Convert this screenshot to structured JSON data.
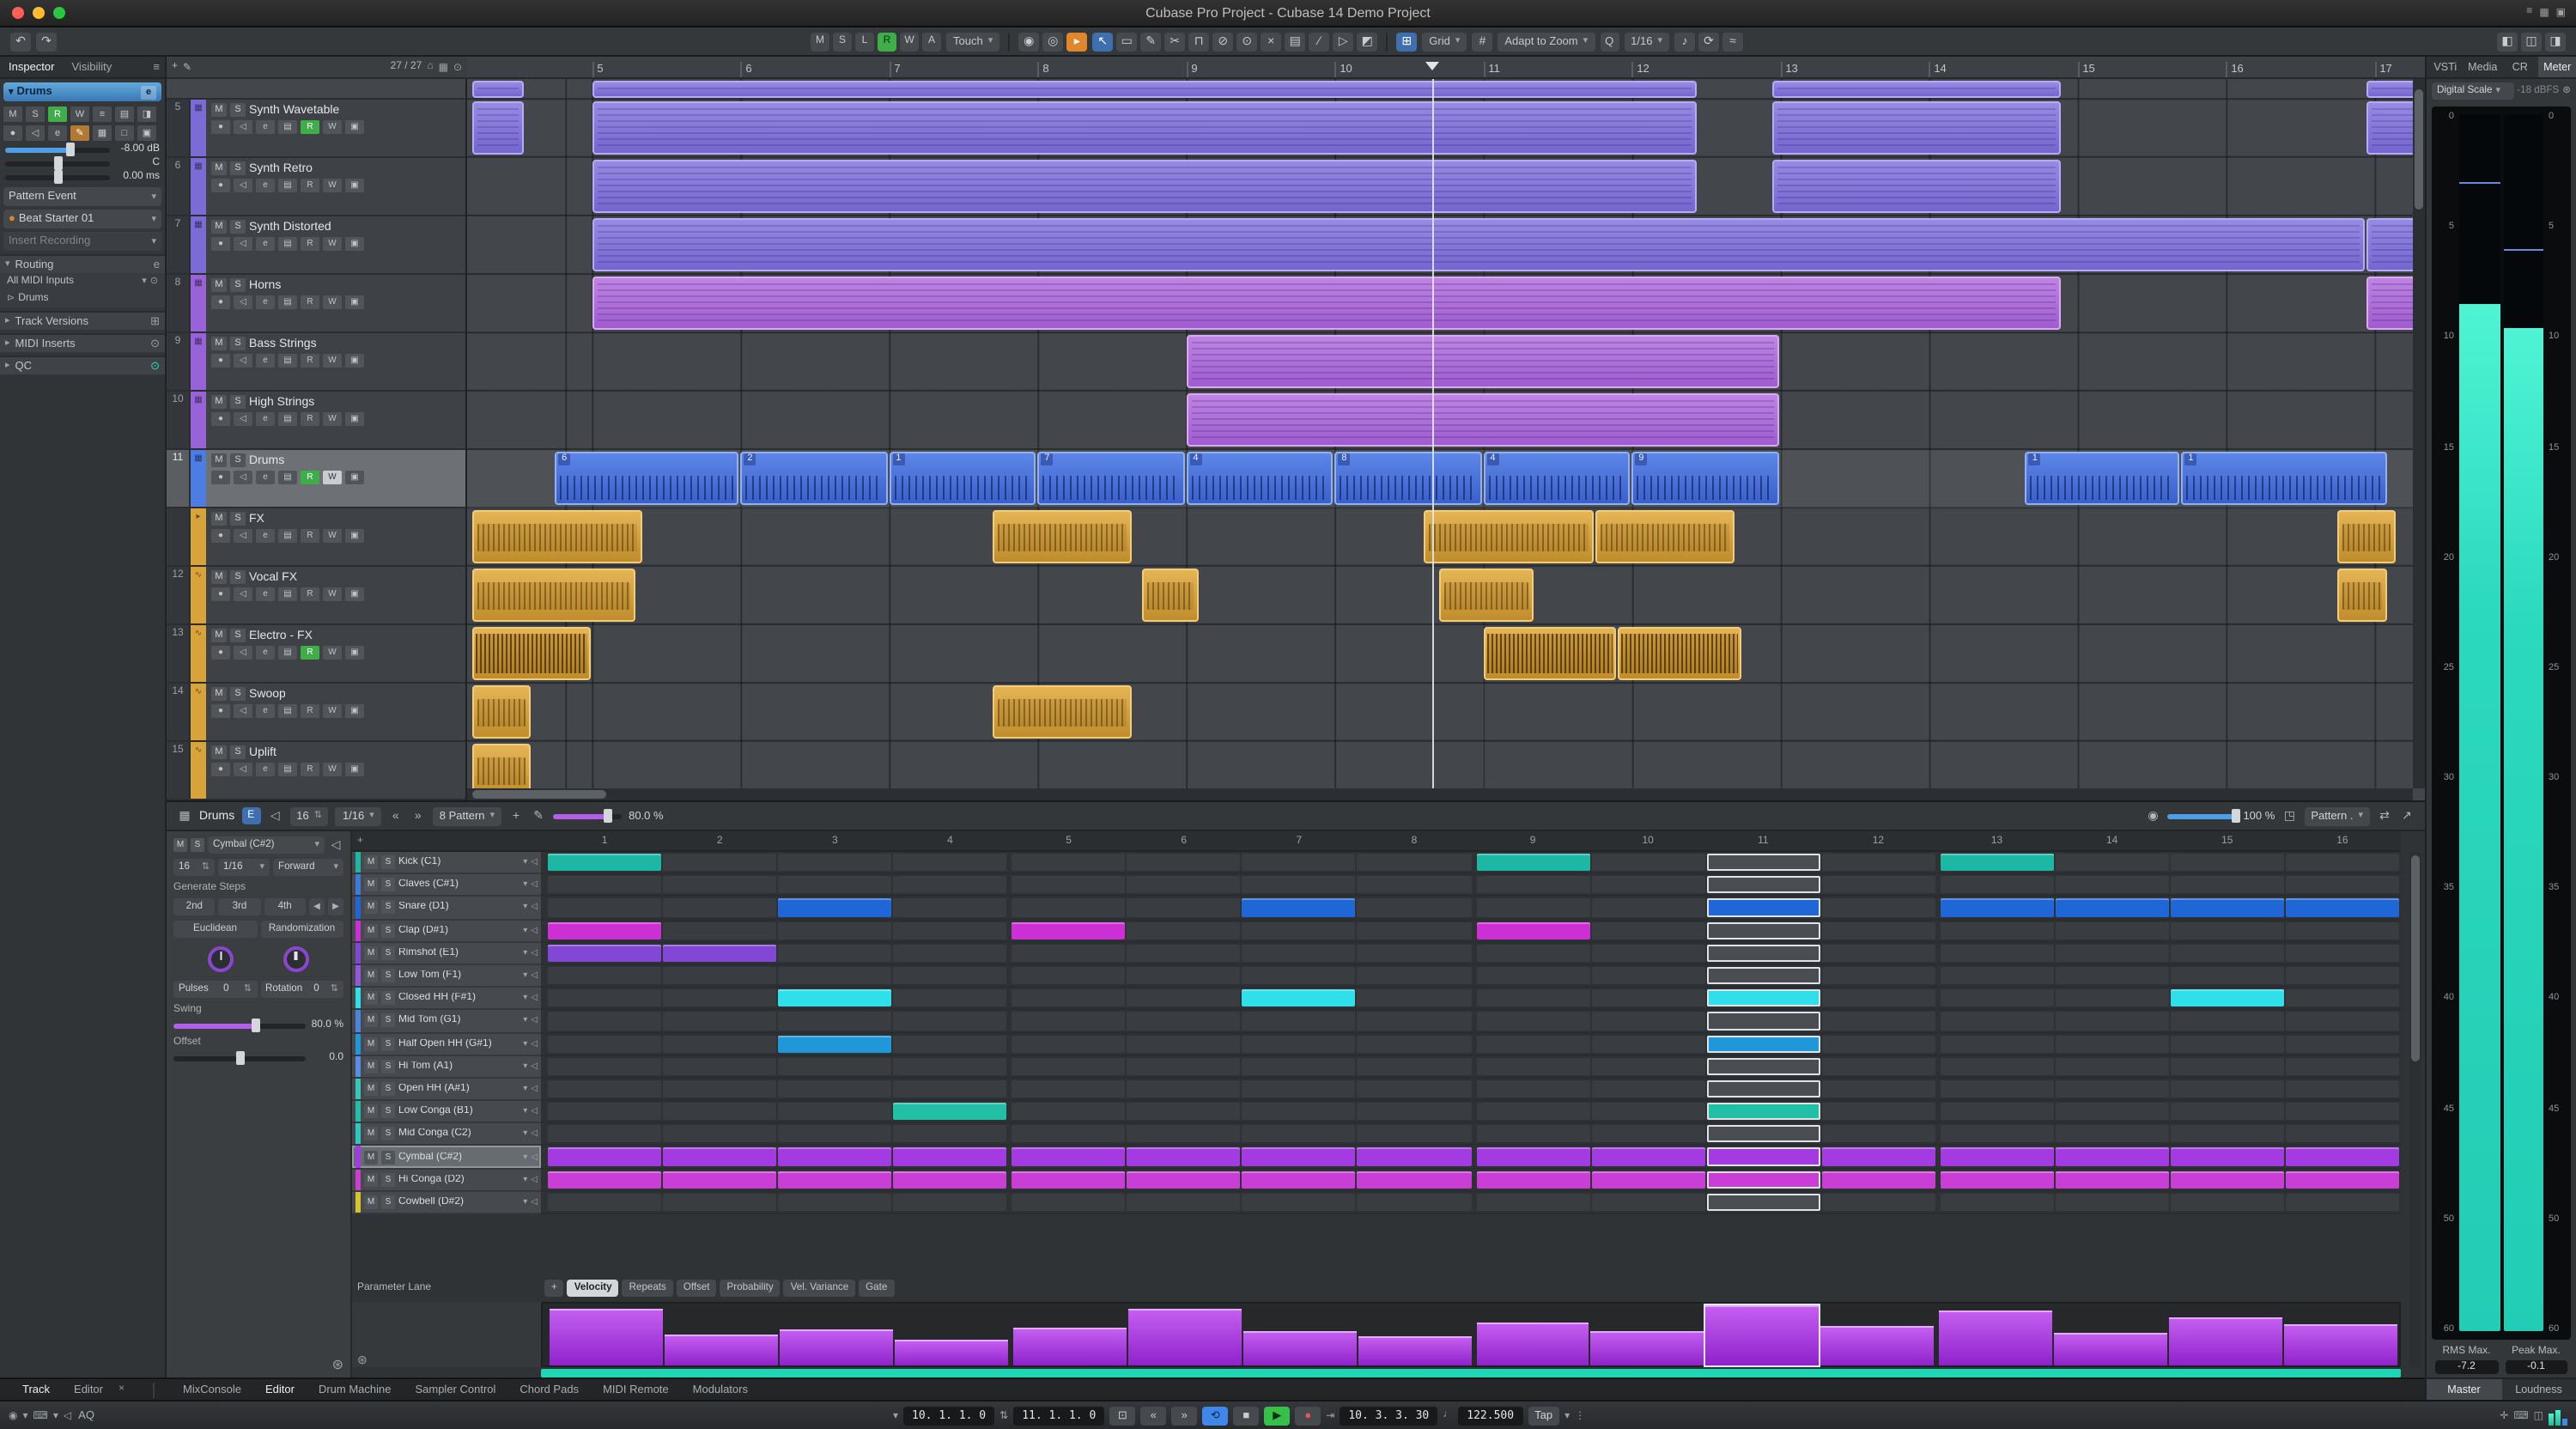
{
  "window": {
    "title": "Cubase Pro Project - Cubase 14 Demo Project",
    "window_icons": [
      {
        "name": "panel-left-icon",
        "glyph": "≡"
      },
      {
        "name": "panel-grid-icon",
        "glyph": "▦"
      },
      {
        "name": "panel-stack-icon",
        "glyph": "▣"
      }
    ]
  },
  "toolbar": {
    "left_icons": [
      {
        "name": "undo-icon",
        "glyph": "↶"
      },
      {
        "name": "redo-icon",
        "glyph": "↷"
      }
    ],
    "automation_buttons": [
      {
        "label": "M"
      },
      {
        "label": "S"
      },
      {
        "label": "L"
      },
      {
        "label": "R",
        "on": true
      },
      {
        "label": "W"
      },
      {
        "label": "A"
      }
    ],
    "automation_mode": "Touch",
    "pre_tools": [
      {
        "name": "activate-icon",
        "glyph": "◉"
      },
      {
        "name": "feedback-icon",
        "glyph": "◎"
      },
      {
        "name": "audition-icon",
        "glyph": "▸",
        "accent": "#e2862c"
      }
    ],
    "tools": [
      {
        "name": "object-select-tool",
        "glyph": "↖",
        "active": true
      },
      {
        "name": "range-tool",
        "glyph": "▭"
      },
      {
        "name": "draw-tool",
        "glyph": "✎"
      },
      {
        "name": "split-tool",
        "glyph": "✂"
      },
      {
        "name": "glue-tool",
        "glyph": "⊓"
      },
      {
        "name": "erase-tool",
        "glyph": "⊘"
      },
      {
        "name": "zoom-tool",
        "glyph": "⊙"
      },
      {
        "name": "mute-tool",
        "glyph": "×"
      },
      {
        "name": "comp-tool",
        "glyph": "▤"
      },
      {
        "name": "line-tool",
        "glyph": "∕"
      },
      {
        "name": "play-tool",
        "glyph": "▷"
      },
      {
        "name": "color-tool",
        "glyph": "◩"
      }
    ],
    "snap_icon": "⊞",
    "snap_label": "Grid",
    "grid_icon": "#",
    "zoom_label": "Adapt to Zoom",
    "q_label": "Q",
    "quantize_value": "1/16",
    "post_icons": [
      {
        "name": "quantize-panel-icon",
        "glyph": "♪"
      },
      {
        "name": "iterative-quantize-icon",
        "glyph": "⟳"
      },
      {
        "name": "audiowarp-icon",
        "glyph": "≈"
      }
    ],
    "right_icons": [
      {
        "name": "left-zone-icon",
        "glyph": "◧"
      },
      {
        "name": "lower-zone-icon",
        "glyph": "◫"
      },
      {
        "name": "right-zone-icon",
        "glyph": "◨"
      }
    ]
  },
  "inspector": {
    "tabs": [
      {
        "label": "Inspector",
        "active": true
      },
      {
        "label": "Visibility"
      }
    ],
    "menu_icon": "≡",
    "track_name": "Drums",
    "button_rows": [
      [
        {
          "g": "M"
        },
        {
          "g": "S"
        },
        {
          "g": "R",
          "c": "green"
        },
        {
          "g": "W"
        },
        {
          "g": "≡"
        },
        {
          "g": "▤"
        },
        {
          "g": "◨"
        }
      ],
      [
        {
          "g": "●"
        },
        {
          "g": "◁"
        },
        {
          "g": "e"
        },
        {
          "g": "✎",
          "c": "orange"
        },
        {
          "g": "▦"
        },
        {
          "g": "□"
        },
        {
          "g": "▣"
        }
      ]
    ],
    "volume": "-8.00 dB",
    "pan": "C",
    "delay": "0.00 ms",
    "event_mode": "Pattern Event",
    "preset": "Beat Starter 01",
    "insert_recording": "Insert Recording",
    "routing": {
      "label": "Routing",
      "input": "All MIDI Inputs",
      "output": "Drums"
    },
    "sections": [
      {
        "label": "Track Versions",
        "icon": "⊞"
      },
      {
        "label": "MIDI Inserts",
        "icon": "⊙"
      },
      {
        "label": "QC",
        "icon": "⊙",
        "accent": true
      }
    ]
  },
  "tracklist": {
    "add_icon": "+",
    "pen_icon": "✎",
    "count": "27 / 27",
    "head_icons": [
      {
        "name": "home-icon",
        "glyph": "⌂"
      },
      {
        "name": "grid-icon",
        "glyph": "▦"
      },
      {
        "name": "find-track-icon",
        "glyph": "⊙"
      }
    ],
    "tracks": [
      {
        "num": "5",
        "name": "Synth Wavetable",
        "color": "#7b6bd6",
        "kind": "midi",
        "r_on": true
      },
      {
        "num": "6",
        "name": "Synth Retro",
        "color": "#7b6bd6",
        "kind": "midi"
      },
      {
        "num": "7",
        "name": "Synth Distorted",
        "color": "#7b6bd6",
        "kind": "midi"
      },
      {
        "num": "8",
        "name": "Horns",
        "color": "#9a62d8",
        "kind": "midi"
      },
      {
        "num": "9",
        "name": "Bass Strings",
        "color": "#9a62d8",
        "kind": "midi"
      },
      {
        "num": "10",
        "name": "High Strings",
        "color": "#9a62d8",
        "kind": "midi"
      },
      {
        "num": "11",
        "name": "Drums",
        "color": "#4d7de2",
        "kind": "midi",
        "selected": true,
        "r_on": true,
        "w_on": true
      },
      {
        "num": "",
        "name": "FX",
        "color": "#d9a33c",
        "kind": "folder"
      },
      {
        "num": "12",
        "name": "Vocal FX",
        "color": "#d9a33c",
        "kind": "audio"
      },
      {
        "num": "13",
        "name": "Electro - FX",
        "color": "#d9a33c",
        "kind": "audio",
        "r_on": true
      },
      {
        "num": "14",
        "name": "Swoop",
        "color": "#d9a33c",
        "kind": "audio"
      },
      {
        "num": "15",
        "name": "Uplift",
        "color": "#d9a33c",
        "kind": "audio"
      }
    ]
  },
  "arrange": {
    "bars": [
      "5",
      "6",
      "7",
      "8",
      "9",
      "10",
      "11",
      "12",
      "13",
      "14",
      "15",
      "16",
      "17"
    ],
    "start_bar": 4.16,
    "pixels_per_bar": 86.5,
    "playhead_bar": 10.66,
    "clips": [
      {
        "row": -1,
        "from": 4.2,
        "to": 4.55,
        "kind": "purple"
      },
      {
        "row": -1,
        "from": 5,
        "to": 12.45,
        "kind": "purple"
      },
      {
        "row": -1,
        "from": 12.95,
        "to": 14.9,
        "kind": "purple"
      },
      {
        "row": -1,
        "from": 16.95,
        "to": 17.3,
        "kind": "purple"
      },
      {
        "row": 0,
        "from": 4.2,
        "to": 4.55,
        "kind": "purple"
      },
      {
        "row": 0,
        "from": 5,
        "to": 12.45,
        "kind": "purple"
      },
      {
        "row": 0,
        "from": 12.95,
        "to": 14.9,
        "kind": "purple"
      },
      {
        "row": 0,
        "from": 16.95,
        "to": 17.3,
        "kind": "purple"
      },
      {
        "row": 1,
        "from": 5,
        "to": 12.45,
        "kind": "purple"
      },
      {
        "row": 1,
        "from": 12.95,
        "to": 14.9,
        "kind": "purple"
      },
      {
        "row": 2,
        "from": 5,
        "to": 16.95,
        "kind": "purple"
      },
      {
        "row": 2,
        "from": 16.95,
        "to": 17.3,
        "kind": "purple"
      },
      {
        "row": 3,
        "from": 5,
        "to": 14.9,
        "kind": "violet"
      },
      {
        "row": 3,
        "from": 16.95,
        "to": 17.3,
        "kind": "violet"
      },
      {
        "row": 4,
        "from": 9,
        "to": 13,
        "kind": "violet"
      },
      {
        "row": 5,
        "from": 9,
        "to": 13,
        "kind": "violet"
      },
      {
        "row": 6,
        "from": 4.75,
        "to": 6,
        "kind": "blue",
        "label": "6"
      },
      {
        "row": 6,
        "from": 6,
        "to": 7,
        "kind": "blue",
        "label": "2"
      },
      {
        "row": 6,
        "from": 7,
        "to": 8,
        "kind": "blue",
        "label": "1"
      },
      {
        "row": 6,
        "from": 8,
        "to": 9,
        "kind": "blue",
        "label": "7"
      },
      {
        "row": 6,
        "from": 9,
        "to": 10,
        "kind": "blue",
        "label": "4"
      },
      {
        "row": 6,
        "from": 10,
        "to": 11,
        "kind": "blue",
        "label": "8"
      },
      {
        "row": 6,
        "from": 11,
        "to": 12,
        "kind": "blue",
        "label": "4"
      },
      {
        "row": 6,
        "from": 12,
        "to": 13,
        "kind": "blue",
        "label": "9"
      },
      {
        "row": 6,
        "from": 14.65,
        "to": 15.7,
        "kind": "blue",
        "label": "1"
      },
      {
        "row": 6,
        "from": 15.7,
        "to": 17.1,
        "kind": "blue",
        "label": "1"
      },
      {
        "row": 7,
        "from": 4.2,
        "to": 5.35,
        "kind": "orange"
      },
      {
        "row": 7,
        "from": 7.7,
        "to": 8.65,
        "kind": "orange"
      },
      {
        "row": 7,
        "from": 10.6,
        "to": 11.75,
        "kind": "orange"
      },
      {
        "row": 7,
        "from": 11.75,
        "to": 12.7,
        "kind": "orange"
      },
      {
        "row": 7,
        "from": 16.75,
        "to": 17.15,
        "kind": "orange"
      },
      {
        "row": 8,
        "from": 4.2,
        "to": 5.3,
        "kind": "wave"
      },
      {
        "row": 8,
        "from": 8.7,
        "to": 9.1,
        "kind": "wave"
      },
      {
        "row": 8,
        "from": 10.7,
        "to": 11.35,
        "kind": "wave"
      },
      {
        "row": 8,
        "from": 16.75,
        "to": 17.1,
        "kind": "wave"
      },
      {
        "row": 9,
        "from": 4.2,
        "to": 5.0,
        "kind": "dense"
      },
      {
        "row": 9,
        "from": 11.0,
        "to": 11.9,
        "kind": "dense"
      },
      {
        "row": 9,
        "from": 11.9,
        "to": 12.75,
        "kind": "dense"
      },
      {
        "row": 10,
        "from": 4.2,
        "to": 4.6,
        "kind": "wave"
      },
      {
        "row": 10,
        "from": 7.7,
        "to": 8.65,
        "kind": "wave"
      },
      {
        "row": 11,
        "from": 4.2,
        "to": 4.6,
        "kind": "wave"
      }
    ]
  },
  "right_panel": {
    "tabs": [
      {
        "label": "VSTi"
      },
      {
        "label": "Media"
      },
      {
        "label": "CR"
      },
      {
        "label": "Meter",
        "active": true
      }
    ],
    "scale_mode": "Digital Scale",
    "headroom": "-18 dBFS",
    "gear_icon": "⊛",
    "scale": [
      "0",
      "5",
      "10",
      "15",
      "20",
      "25",
      "30",
      "35",
      "40",
      "45",
      "50",
      "60"
    ],
    "channels": [
      {
        "level": 0.845,
        "hold": 0.055
      },
      {
        "level": 0.825,
        "hold": 0.11
      }
    ],
    "rms_label": "RMS Max.",
    "peak_label": "Peak Max.",
    "rms_value": "-7.2",
    "peak_value": "-0.1",
    "bottom_tabs": [
      {
        "label": "Master",
        "active": true
      },
      {
        "label": "Loudness"
      }
    ]
  },
  "editor": {
    "pad_icon": "▦",
    "title": "Drums",
    "e_button": "E",
    "speaker_icon": "◁",
    "steps_value": "16",
    "resolution": "1/16",
    "pattern_select": "8 Pattern",
    "swing_display": "80.0 %",
    "zoom_display": "100 %",
    "pattern_menu": "Pattern .",
    "left": {
      "mute": "M",
      "solo": "S",
      "lane_select": "Cymbal (C#2)",
      "steps": "16",
      "resolution": "1/16",
      "direction": "Forward",
      "generate_label": "Generate Steps",
      "gen_buttons": [
        "2nd",
        "3rd",
        "4th"
      ],
      "algo_buttons": [
        "Euclidean",
        "Randomization"
      ],
      "knobs": [
        {
          "label": "Pulses",
          "value": "0"
        },
        {
          "label": "Rotation",
          "value": "0"
        }
      ],
      "swing_label": "Swing",
      "swing_value": "80.0 %",
      "offset_label": "Offset",
      "offset_value": "0.0"
    },
    "current_step": 11,
    "lanes": [
      {
        "name": "Kick (C1)",
        "color": "#1cb8a4",
        "steps": [
          1,
          9,
          13
        ]
      },
      {
        "name": "Claves (C#1)",
        "color": "#3d7bd9",
        "steps": []
      },
      {
        "name": "Snare (D1)",
        "color": "#1f66d6",
        "steps": [
          3,
          7,
          11,
          13,
          14,
          15,
          16
        ]
      },
      {
        "name": "Clap (D#1)",
        "color": "#cc2fd4",
        "steps": [
          1,
          5,
          9
        ]
      },
      {
        "name": "Rimshot (E1)",
        "color": "#8347d6",
        "steps": [
          1,
          2
        ]
      },
      {
        "name": "Low Tom (F1)",
        "color": "#9357e0",
        "steps": []
      },
      {
        "name": "Closed HH (F#1)",
        "color": "#2fdfea",
        "steps": [
          3,
          7,
          11,
          15
        ]
      },
      {
        "name": "Mid Tom (G1)",
        "color": "#4a85e0",
        "steps": []
      },
      {
        "name": "Half Open HH (G#1)",
        "color": "#1f97d8",
        "steps": [
          3,
          11
        ]
      },
      {
        "name": "Hi Tom (A1)",
        "color": "#5b8de6",
        "steps": []
      },
      {
        "name": "Open HH (A#1)",
        "color": "#35c8b5",
        "steps": []
      },
      {
        "name": "Low Conga (B1)",
        "color": "#21bfa6",
        "steps": [
          4,
          11
        ]
      },
      {
        "name": "Mid Conga (C2)",
        "color": "#2cc9c0",
        "steps": []
      },
      {
        "name": "Cymbal (C#2)",
        "color": "#a43ae2",
        "steps": [
          1,
          2,
          3,
          4,
          5,
          6,
          7,
          8,
          9,
          10,
          11,
          12,
          13,
          14,
          15,
          16
        ],
        "selected": true
      },
      {
        "name": "Hi Conga (D2)",
        "color": "#c93fd6",
        "steps": [
          1,
          2,
          3,
          4,
          5,
          6,
          7,
          8,
          9,
          10,
          11,
          12,
          13,
          14,
          15,
          16
        ]
      },
      {
        "name": "Cowbell (D#2)",
        "color": "#d8c42a",
        "steps": []
      }
    ],
    "param_lane_label": "Parameter Lane",
    "param_add": "+",
    "param_tabs": [
      {
        "label": "Velocity",
        "active": true
      },
      {
        "label": "Repeats"
      },
      {
        "label": "Offset"
      },
      {
        "label": "Probability"
      },
      {
        "label": "Vel. Variance"
      },
      {
        "label": "Gate"
      }
    ],
    "velocity": [
      115,
      62,
      72,
      55,
      78,
      118,
      70,
      60,
      88,
      70,
      122,
      80,
      112,
      68,
      98,
      85
    ]
  },
  "zone_tabs": {
    "left": [
      {
        "label": "Track",
        "active": true
      },
      {
        "label": "Editor"
      }
    ],
    "close_icon": "×",
    "main": [
      {
        "label": "MixConsole"
      },
      {
        "label": "Editor",
        "active": true
      },
      {
        "label": "Drum Machine"
      },
      {
        "label": "Sampler Control"
      },
      {
        "label": "Chord Pads"
      },
      {
        "label": "MIDI Remote"
      },
      {
        "label": "Modulators"
      }
    ]
  },
  "transport": {
    "left_icons": [
      {
        "name": "metronome-icon",
        "glyph": "◉"
      },
      {
        "name": "caret-icon",
        "glyph": "▾"
      },
      {
        "name": "midi-keyboard-icon",
        "glyph": "⌨"
      },
      {
        "name": "caret-icon",
        "glyph": "▾"
      },
      {
        "name": "speaker-icon",
        "glyph": "◁"
      }
    ],
    "aq": "AQ",
    "left_locator": "10. 1. 1. 0",
    "right_locator": "11. 1. 1. 0",
    "position": "10. 3. 3. 30",
    "tempo": "122.500",
    "tap": "Tap",
    "sig_icon": "♩",
    "right_icons": [
      {
        "name": "crosshair-icon",
        "glyph": "✛"
      },
      {
        "name": "keyboard-icon",
        "glyph": "⌨"
      },
      {
        "name": "panel-icon",
        "glyph": "◫"
      }
    ]
  }
}
